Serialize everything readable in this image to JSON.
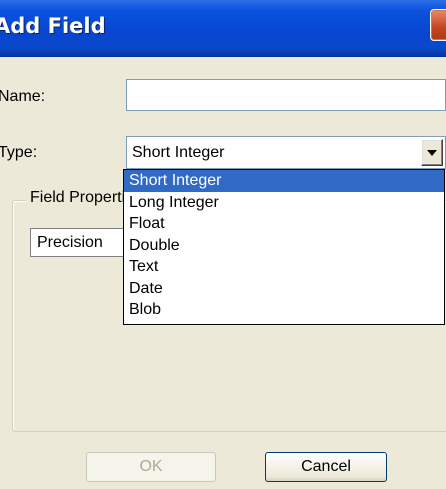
{
  "window": {
    "title": "Add Field"
  },
  "form": {
    "name_label": "Name:",
    "name_value": "",
    "type_label": "Type:",
    "type_value": "Short Integer"
  },
  "field_properties": {
    "legend": "Field Properties",
    "rows": [
      {
        "property": "Precision"
      }
    ]
  },
  "type_dropdown": {
    "options": [
      "Short Integer",
      "Long Integer",
      "Float",
      "Double",
      "Text",
      "Date",
      "Blob"
    ],
    "selected_index": 0
  },
  "buttons": {
    "ok_label": "OK",
    "cancel_label": "Cancel"
  },
  "colors": {
    "title_bar": "#0a48cc",
    "selection": "#316ac5",
    "dialog_bg": "#ece9d8"
  },
  "icons": {
    "close": "close-icon",
    "dropdown": "chevron-down-icon"
  }
}
